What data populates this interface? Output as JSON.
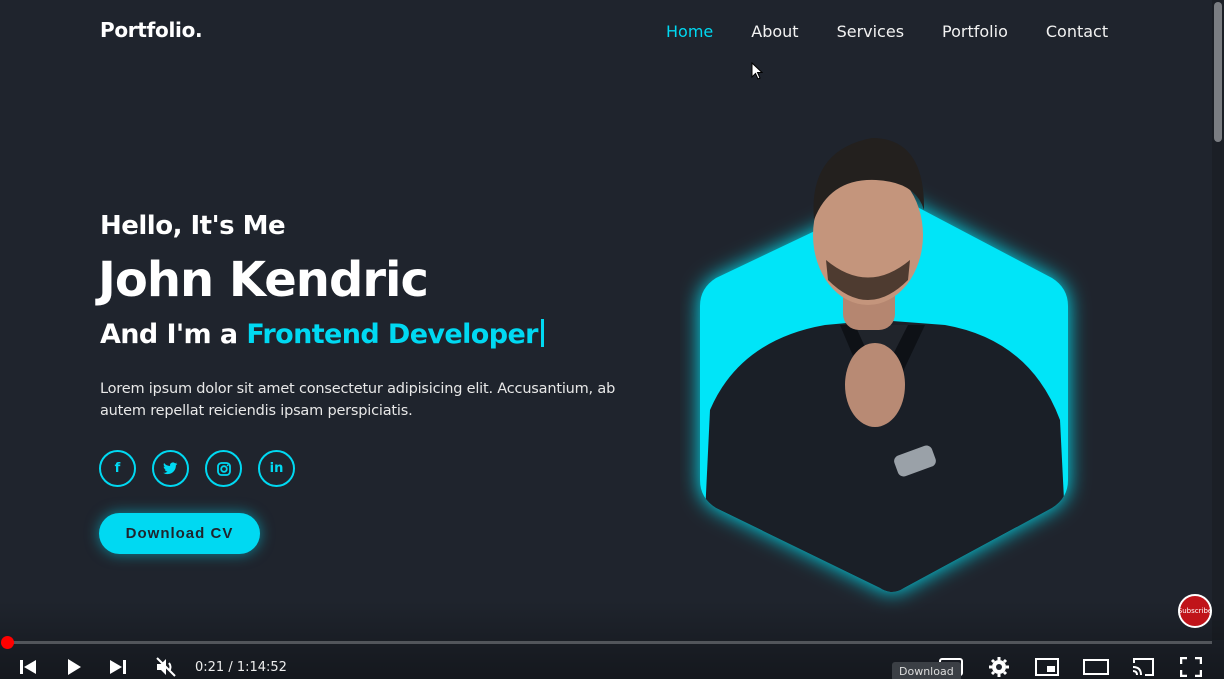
{
  "header": {
    "logo": "Portfolio.",
    "nav": [
      {
        "label": "Home",
        "active": true
      },
      {
        "label": "About",
        "active": false
      },
      {
        "label": "Services",
        "active": false
      },
      {
        "label": "Portfolio",
        "active": false
      },
      {
        "label": "Contact",
        "active": false
      }
    ]
  },
  "hero": {
    "greeting": "Hello, It's Me",
    "name": "John Kendric",
    "role_prefix": "And I'm a ",
    "role_highlight": "Frontend Developer",
    "description": "Lorem ipsum dolor sit amet consectetur adipisicing elit. Accusantium, ab autem repellat reiciendis ipsam perspiciatis.",
    "socials": [
      {
        "icon": "facebook-icon",
        "glyph": "f"
      },
      {
        "icon": "twitter-icon",
        "glyph": "t"
      },
      {
        "icon": "instagram-icon",
        "glyph": "◘"
      },
      {
        "icon": "linkedin-icon",
        "glyph": "in"
      }
    ],
    "cta_label": "Download CV",
    "accent_color": "#00d9f2"
  },
  "player": {
    "time_display": "0:21 / 1:14:52",
    "tooltip": "Download",
    "subscribe_label": "Subscribe",
    "progress": 0.005,
    "controls": [
      "previous-icon",
      "play-icon",
      "next-icon",
      "mute-icon",
      "subtitles-icon",
      "settings-icon",
      "miniplayer-icon",
      "theater-icon",
      "cast-icon",
      "fullscreen-icon"
    ]
  }
}
